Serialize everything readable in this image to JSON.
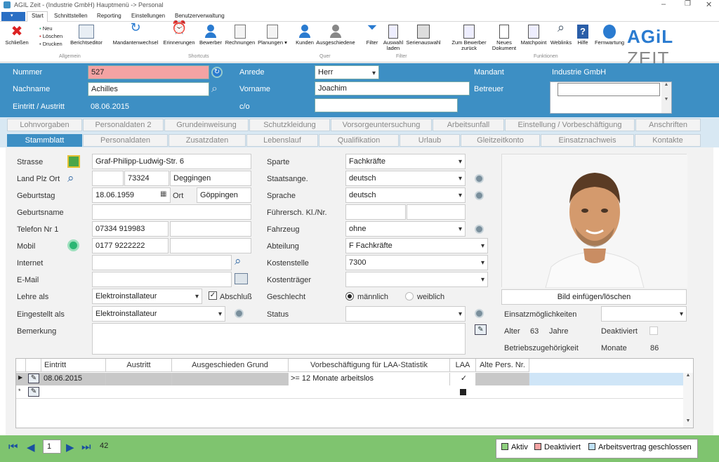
{
  "titlebar": {
    "title": "AGIL Zeit - (Industrie GmbH) Hauptmenü -> Personal"
  },
  "menu": [
    "Start",
    "Schnittstellen",
    "Reporting",
    "Einstellungen",
    "Benutzerverwaltung"
  ],
  "ribbon": {
    "allgemein": {
      "close": "Schließen",
      "new": "Neu",
      "delete": "Löschen",
      "print": "Drucken",
      "report": "Berichtseditor",
      "group": "Allgemein"
    },
    "shortcuts": {
      "mandant": "Mandantenwechsel",
      "reminders": "Erinnerungen",
      "applicant": "Bewerber",
      "invoices": "Rechnungen",
      "plans": "Planungen",
      "group": "Shortcuts"
    },
    "quer": {
      "customers": "Kunden",
      "retired": "Ausgeschiedene",
      "group": "Quer"
    },
    "filter": {
      "filter": "Filter",
      "load": "Auswahl laden",
      "serial": "Serienauswahl",
      "group": "Filter"
    },
    "funktionen": {
      "to_applicant": "Zum Bewerber zurück",
      "new_doc": "Neues Dokument",
      "matchpoint": "Matchpoint",
      "weblinks": "Weblinks",
      "help": "Hilfe",
      "remote": "Fernwartung",
      "group": "Funktionen"
    },
    "logo": "AGiL ZEIT"
  },
  "header": {
    "nummer_label": "Nummer",
    "nummer": "527",
    "nachname_label": "Nachname",
    "nachname": "Achilles",
    "eintritt_label": "Eintritt / Austritt",
    "eintritt": "08.06.2015",
    "anrede_label": "Anrede",
    "anrede": "Herr",
    "vorname_label": "Vorname",
    "vorname": "Joachim",
    "co_label": "c/o",
    "co": "",
    "mandant_label": "Mandant",
    "mandant": "Industrie GmbH",
    "betreuer_label": "Betreuer"
  },
  "tabs_row1": [
    "Lohnvorgaben",
    "Personaldaten 2",
    "Grundeinweisung",
    "Schutzkleidung",
    "Vorsorgeuntersuchung",
    "Arbeitsunfall",
    "Einstellung / Vorbeschäftigung",
    "Anschriften"
  ],
  "tabs_row2": [
    "Stammblatt",
    "Personaldaten",
    "Zusatzdaten",
    "Lebenslauf",
    "Qualifikation",
    "Urlaub",
    "Gleitzeitkonto",
    "Einsatznachweis",
    "Kontakte"
  ],
  "form": {
    "strasse_label": "Strasse",
    "strasse": "Graf-Philipp-Ludwig-Str. 6",
    "land_label": "Land Plz Ort",
    "plz": "73324",
    "ort": "Deggingen",
    "geburtstag_label": "Geburtstag",
    "geburtstag": "18.06.1959",
    "ort_label": "Ort",
    "geburtsort": "Göppingen",
    "geburtsname_label": "Geburtsname",
    "telefon_label": "Telefon Nr 1",
    "telefon": "07334 919983",
    "mobil_label": "Mobil",
    "mobil": "0177 9222222",
    "internet_label": "Internet",
    "email_label": "E-Mail",
    "lehre_label": "Lehre als",
    "lehre": "Elektroinstallateur",
    "abschluss_label": "Abschluß",
    "eingestellt_label": "Eingestellt als",
    "eingestellt": "Elektroinstallateur",
    "bemerkung_label": "Bemerkung",
    "sparte_label": "Sparte",
    "sparte": "Fachkräfte",
    "staat_label": "Staatsange.",
    "staat": "deutsch",
    "sprache_label": "Sprache",
    "sprache": "deutsch",
    "fuehrer_label": "Führersch. Kl./Nr.",
    "fahrzeug_label": "Fahrzeug",
    "fahrzeug": "ohne",
    "abteilung_label": "Abteilung",
    "abteilung": "F Fachkräfte",
    "kosten_label": "Kostenstelle",
    "kosten": "7300",
    "traeger_label": "Kostenträger",
    "geschlecht_label": "Geschlecht",
    "maennlich": "männlich",
    "weiblich": "weiblich",
    "status_label": "Status",
    "bild_button": "Bild einfügen/löschen",
    "einsatz_label": "Einsatzmöglichkeiten",
    "alter_label": "Alter",
    "alter": "63",
    "jahre": "Jahre",
    "deaktiviert_label": "Deaktiviert",
    "betrieb_label": "Betriebszugehörigkeit",
    "monate_label": "Monate",
    "monate": "86"
  },
  "grid": {
    "headers": [
      "Eintritt",
      "Austritt",
      "Ausgeschieden Grund",
      "Vorbeschäftigung für LAA-Statistik",
      "LAA",
      "Alte Pers. Nr."
    ],
    "row": {
      "eintritt": "08.06.2015",
      "vorbeschaeftigung": ">= 12 Monate arbeitslos"
    }
  },
  "status": {
    "page": "1",
    "count": "42",
    "legend": [
      {
        "label": "Aktiv",
        "color": "#8fd07f"
      },
      {
        "label": "Deaktiviert",
        "color": "#f4a3a3"
      },
      {
        "label": "Arbeitsvertrag geschlossen",
        "color": "#bfe0f5"
      }
    ]
  },
  "colors": {
    "header_blue": "#3d8fc4",
    "status_green": "#7fc46f",
    "nummer_bg": "#f4a3a3"
  }
}
